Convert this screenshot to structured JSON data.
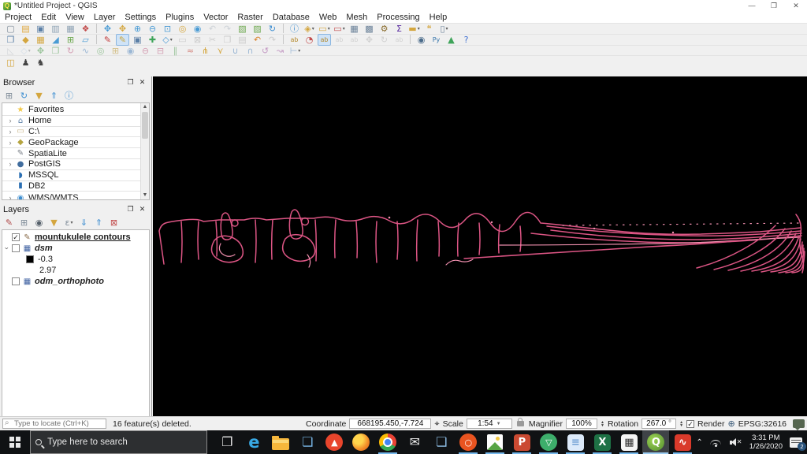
{
  "window": {
    "title": "*Untitled Project - QGIS",
    "minimize": "—",
    "restore": "❐",
    "close": "✕"
  },
  "menu": {
    "items": [
      "Project",
      "Edit",
      "View",
      "Layer",
      "Settings",
      "Plugins",
      "Vector",
      "Raster",
      "Database",
      "Web",
      "Mesh",
      "Processing",
      "Help"
    ]
  },
  "toolbars": {
    "row1": [
      {
        "n": "new-project-icon",
        "g": "▢",
        "c": "#7d8a97"
      },
      {
        "n": "open-project-icon",
        "g": "▤",
        "c": "#e0a93f"
      },
      {
        "n": "save-project-icon",
        "g": "▣",
        "c": "#5b7fa6"
      },
      {
        "n": "new-print-layout-icon",
        "g": "▥",
        "c": "#8fa3b5"
      },
      {
        "n": "layout-manager-icon",
        "g": "▦",
        "c": "#8fa3b5"
      },
      {
        "n": "style-manager-icon",
        "g": "❖",
        "c": "#c24d4d"
      },
      {
        "n": "separator"
      },
      {
        "n": "pan-map-icon",
        "g": "✥",
        "c": "#4a9bd4"
      },
      {
        "n": "pan-to-selection-icon",
        "g": "✥",
        "c": "#d4a63f"
      },
      {
        "n": "zoom-in-icon",
        "g": "⊕",
        "c": "#4a9bd4"
      },
      {
        "n": "zoom-out-icon",
        "g": "⊖",
        "c": "#4a9bd4"
      },
      {
        "n": "zoom-full-icon",
        "g": "⊡",
        "c": "#4a9bd4"
      },
      {
        "n": "zoom-to-selection-icon",
        "g": "◎",
        "c": "#d4a63f"
      },
      {
        "n": "zoom-to-layer-icon",
        "g": "◉",
        "c": "#4a9bd4"
      },
      {
        "n": "zoom-last-icon",
        "g": "↶",
        "c": "#8a9aa8",
        "d": 1
      },
      {
        "n": "zoom-next-icon",
        "g": "↷",
        "c": "#8a9aa8",
        "d": 1
      },
      {
        "n": "new-map-view-icon",
        "g": "▧",
        "c": "#6da84f"
      },
      {
        "n": "new-3d-map-view-icon",
        "g": "▨",
        "c": "#6da84f"
      },
      {
        "n": "refresh-map-icon",
        "g": "↻",
        "c": "#3f8fd1"
      },
      {
        "n": "separator"
      },
      {
        "n": "identify-features-icon",
        "g": "ⓘ",
        "c": "#3f8fd1"
      },
      {
        "n": "run-feature-action-icon",
        "g": "◈",
        "c": "#d4a63f",
        "v": 1
      },
      {
        "n": "select-features-icon",
        "g": "▭",
        "c": "#d4a63f",
        "v": 1
      },
      {
        "n": "deselect-features-icon",
        "g": "▭",
        "c": "#c24d4d",
        "v": 1
      },
      {
        "n": "open-attribute-table-icon",
        "g": "▦",
        "c": "#6b8299"
      },
      {
        "n": "field-calculator-icon",
        "g": "▩",
        "c": "#6b8299"
      },
      {
        "n": "processing-toolbox-icon",
        "g": "⚙",
        "c": "#8a6d2f"
      },
      {
        "n": "statistics-icon",
        "g": "Σ",
        "c": "#5a2ca0"
      },
      {
        "n": "measure-icon",
        "g": "▬",
        "c": "#d4a63f",
        "v": 1
      },
      {
        "n": "map-tips-icon",
        "g": "❝",
        "c": "#d4a63f"
      },
      {
        "n": "text-annotation-icon",
        "g": "▯",
        "c": "#6b8299",
        "v": 1
      }
    ],
    "row2": [
      {
        "n": "data-source-manager-icon",
        "g": "❐",
        "c": "#5b7fa6"
      },
      {
        "n": "add-vector-layer-icon",
        "g": "◆",
        "c": "#d4a63f"
      },
      {
        "n": "add-raster-layer-icon",
        "g": "▦",
        "c": "#d4a63f"
      },
      {
        "n": "add-mesh-layer-icon",
        "g": "◢",
        "c": "#4a9bd4"
      },
      {
        "n": "add-delimited-text-icon",
        "g": "⊞",
        "c": "#6da84f"
      },
      {
        "n": "new-shapefile-layer-icon",
        "g": "▱",
        "c": "#4a9bd4"
      },
      {
        "n": "separator"
      },
      {
        "n": "current-edits-icon",
        "g": "✎",
        "c": "#c23b3b"
      },
      {
        "n": "toggle-editing-icon",
        "g": "✎",
        "c": "#caa53d",
        "a": 1
      },
      {
        "n": "save-layer-edits-icon",
        "g": "▣",
        "c": "#5b7fa6"
      },
      {
        "n": "add-line-feature-icon",
        "g": "✚",
        "c": "#3fa45a"
      },
      {
        "n": "vertex-tool-icon",
        "g": "◇",
        "c": "#4a9bd4",
        "v": 1
      },
      {
        "n": "modify-attributes-icon",
        "g": "▭",
        "c": "#888",
        "d": 1
      },
      {
        "n": "delete-selected-icon",
        "g": "⊠",
        "c": "#888",
        "d": 1
      },
      {
        "n": "cut-features-icon",
        "g": "✂",
        "c": "#888",
        "d": 1
      },
      {
        "n": "copy-features-icon",
        "g": "❐",
        "c": "#888",
        "d": 1
      },
      {
        "n": "paste-features-icon",
        "g": "▤",
        "c": "#888",
        "d": 1
      },
      {
        "n": "undo-icon",
        "g": "↶",
        "c": "#d9822b"
      },
      {
        "n": "redo-icon",
        "g": "↷",
        "c": "#888",
        "d": 1
      },
      {
        "n": "separator"
      },
      {
        "n": "layer-labeling-icon",
        "g": "ab",
        "c": "#b58a2f"
      },
      {
        "n": "layer-diagrams-icon",
        "g": "◔",
        "c": "#c24d4d"
      },
      {
        "n": "highlight-labels-icon",
        "g": "ab",
        "c": "#b58a2f",
        "a": 1
      },
      {
        "n": "pin-labels-icon",
        "g": "ab",
        "c": "#999",
        "d": 1
      },
      {
        "n": "show-hide-labels-icon",
        "g": "ab",
        "c": "#999",
        "d": 1
      },
      {
        "n": "move-label-icon",
        "g": "✥",
        "c": "#999",
        "d": 1
      },
      {
        "n": "rotate-label-icon",
        "g": "↻",
        "c": "#999",
        "d": 1
      },
      {
        "n": "change-label-icon",
        "g": "ab",
        "c": "#999",
        "d": 1
      },
      {
        "n": "separator"
      },
      {
        "n": "metasearch-icon",
        "g": "◉",
        "c": "#4a6b8a"
      },
      {
        "n": "python-console-icon",
        "g": "Py",
        "c": "#3776ab"
      },
      {
        "n": "basemap-plugin-icon",
        "g": "▲",
        "c": "#3fa45a"
      },
      {
        "n": "help-contents-icon",
        "g": "?",
        "c": "#3f6fd1"
      }
    ],
    "row3": [
      {
        "n": "advanced-digitizing-icon",
        "g": "◺",
        "c": "#a0a8b0",
        "d": 1
      },
      {
        "n": "cad-tools-icon",
        "g": "◇",
        "c": "#9bb7d4",
        "v": 1,
        "d": 1
      },
      {
        "n": "move-feature-icon",
        "g": "✥",
        "c": "#9bc49b"
      },
      {
        "n": "copy-move-feature-icon",
        "g": "❐",
        "c": "#9bc49b"
      },
      {
        "n": "rotate-feature-icon",
        "g": "↻",
        "c": "#d4a0b4"
      },
      {
        "n": "simplify-feature-icon",
        "g": "∿",
        "c": "#9bb7d4"
      },
      {
        "n": "add-ring-icon",
        "g": "◎",
        "c": "#9bc49b"
      },
      {
        "n": "add-part-icon",
        "g": "⊞",
        "c": "#d4c08a"
      },
      {
        "n": "fill-ring-icon",
        "g": "◉",
        "c": "#9bb7d4"
      },
      {
        "n": "delete-ring-icon",
        "g": "⊖",
        "c": "#d4a0b4"
      },
      {
        "n": "delete-part-icon",
        "g": "⊟",
        "c": "#d4a0b4"
      },
      {
        "n": "offset-curve-icon",
        "g": "∥",
        "c": "#9bc49b"
      },
      {
        "n": "reshape-features-icon",
        "g": "≈",
        "c": "#d4877f"
      },
      {
        "n": "split-features-icon",
        "g": "⋔",
        "c": "#d4a63f"
      },
      {
        "n": "split-parts-icon",
        "g": "⋎",
        "c": "#d4a63f"
      },
      {
        "n": "merge-features-icon",
        "g": "∪",
        "c": "#9bb7d4"
      },
      {
        "n": "merge-attributes-icon",
        "g": "∩",
        "c": "#9bb7d4"
      },
      {
        "n": "rotate-point-symbols-icon",
        "g": "↺",
        "c": "#c49bc4"
      },
      {
        "n": "offset-point-symbol-icon",
        "g": "↝",
        "c": "#c49bc4"
      },
      {
        "n": "trim-extend-icon",
        "g": "⊢",
        "c": "#9bb7d4",
        "v": 1
      }
    ],
    "row4": [
      {
        "n": "db-manager-plugin-icon",
        "g": "◫",
        "c": "#d4a63f"
      },
      {
        "n": "plugin-tool-icon-1",
        "g": "♟",
        "c": "#444444"
      },
      {
        "n": "plugin-tool-icon-2",
        "g": "♞",
        "c": "#444444"
      }
    ]
  },
  "browser": {
    "title": "Browser",
    "tools": [
      {
        "n": "add-selected-layers-icon",
        "g": "⊞",
        "c": "#7d8a97"
      },
      {
        "n": "refresh-browser-icon",
        "g": "↻",
        "c": "#3f8fd1"
      },
      {
        "n": "filter-browser-icon",
        "g": "▼",
        "c": "#d4a63f"
      },
      {
        "n": "collapse-all-icon",
        "g": "⇑",
        "c": "#3f8fd1"
      },
      {
        "n": "browser-properties-icon",
        "g": "ⓘ",
        "c": "#3f8fd1"
      }
    ],
    "items": [
      {
        "n": "browser-item-favorites",
        "icon": "favorites-star-icon",
        "g": "★",
        "c": "#f2c744",
        "label": "Favorites",
        "arrow": false
      },
      {
        "n": "browser-item-home",
        "icon": "home-icon",
        "g": "⌂",
        "c": "#5b7fa6",
        "label": "Home",
        "arrow": true
      },
      {
        "n": "browser-item-c-drive",
        "icon": "folder-icon",
        "g": "▭",
        "c": "#c9b68a",
        "label": "C:\\",
        "arrow": true
      },
      {
        "n": "browser-item-geopackage",
        "icon": "geopackage-icon",
        "g": "◆",
        "c": "#b5a43f",
        "label": "GeoPackage",
        "arrow": true
      },
      {
        "n": "browser-item-spatialite",
        "icon": "spatialite-icon",
        "g": "✎",
        "c": "#7a8088",
        "label": "SpatiaLite",
        "arrow": false
      },
      {
        "n": "browser-item-postgis",
        "icon": "postgis-elephant-icon",
        "g": "●",
        "c": "#416d9e",
        "label": "PostGIS",
        "arrow": true
      },
      {
        "n": "browser-item-mssql",
        "icon": "mssql-icon",
        "g": "◗",
        "c": "#2b6fb3",
        "label": "MSSQL",
        "arrow": false
      },
      {
        "n": "browser-item-db2",
        "icon": "db2-icon",
        "g": "▮",
        "c": "#2b6fb3",
        "label": "DB2",
        "arrow": false
      },
      {
        "n": "browser-item-wms",
        "icon": "wms-globe-icon",
        "g": "◉",
        "c": "#3f8fd1",
        "label": "WMS/WMTS",
        "arrow": true
      }
    ]
  },
  "layers": {
    "title": "Layers",
    "tools": [
      {
        "n": "layer-styling-icon",
        "g": "✎",
        "c": "#b04a4a"
      },
      {
        "n": "add-group-icon",
        "g": "⊞",
        "c": "#7d8a97"
      },
      {
        "n": "map-themes-icon",
        "g": "◉",
        "c": "#55606a"
      },
      {
        "n": "filter-legend-icon",
        "g": "▼",
        "c": "#d4a63f"
      },
      {
        "n": "filter-expression-icon",
        "g": "ε",
        "c": "#7d8a97",
        "v": 1
      },
      {
        "n": "expand-all-icon",
        "g": "⇓",
        "c": "#3f8fd1"
      },
      {
        "n": "collapse-all-layers-icon",
        "g": "⇑",
        "c": "#3f8fd1"
      },
      {
        "n": "remove-layer-icon",
        "g": "⊠",
        "c": "#c24d4d"
      }
    ],
    "items": [
      {
        "type": "layer",
        "n": "layer-item-mountukulele-contours",
        "checked": true,
        "icon": "vector-line-layer-icon",
        "g": "✎",
        "c": "#8a6d4b",
        "label": "mountukulele contours",
        "style": "bold-underline"
      },
      {
        "type": "layer",
        "n": "layer-item-dsm",
        "expand": true,
        "checked": false,
        "icon": "raster-layer-icon",
        "g": "▦",
        "c": "#3c5fa0",
        "label": "dsm",
        "style": "italic"
      },
      {
        "type": "legend",
        "n": "legend-entry-min",
        "swatch": "#000000",
        "label": "-0.3"
      },
      {
        "type": "legend",
        "n": "legend-entry-max",
        "swatch": "",
        "label": "2.97"
      },
      {
        "type": "layer",
        "n": "layer-item-odm-orthophoto",
        "checked": false,
        "icon": "raster-layer-icon",
        "g": "▦",
        "c": "#3c5fa0",
        "label": "odm_orthophoto",
        "style": "italic"
      }
    ]
  },
  "map": {
    "contour_color": "#dc5584",
    "contour_light": "#ef8fae",
    "background": "#000000"
  },
  "statusbar": {
    "locate_placeholder": "Type to locate (Ctrl+K)",
    "message": "16 feature(s) deleted.",
    "coordinate_label": "Coordinate",
    "coordinate_value": "668195.450,-7.724",
    "scale_label": "Scale",
    "scale_value": "1:54",
    "magnifier_label": "Magnifier",
    "magnifier_value": "100%",
    "rotation_label": "Rotation",
    "rotation_value": "267.0",
    "rotation_unit": "°",
    "render_label": "Render",
    "crs": "EPSG:32616"
  },
  "taskbar": {
    "search_placeholder": "Type here to search",
    "apps": [
      {
        "n": "task-view-button",
        "shape": "plain",
        "g": "❐",
        "fg": "#e8e8e8"
      },
      {
        "n": "edge-icon",
        "shape": "edge",
        "g": "e"
      },
      {
        "n": "file-explorer-icon",
        "shape": "folder"
      },
      {
        "n": "remote-desktop-icon",
        "shape": "plain",
        "g": "❏",
        "fg": "#79b7e8"
      },
      {
        "n": "brave-icon",
        "shape": "circle",
        "bg": "#e8452c",
        "g": "▲",
        "fg": "#ffffff"
      },
      {
        "n": "firefox-icon",
        "shape": "firefox"
      },
      {
        "n": "chrome-icon",
        "shape": "chrome",
        "run": 1
      },
      {
        "n": "mail-icon",
        "shape": "plain",
        "g": "✉",
        "fg": "#f0f0f0"
      },
      {
        "n": "network-computers-icon",
        "shape": "plain",
        "g": "❏",
        "fg": "#8fc0e8"
      },
      {
        "n": "ubuntu-icon",
        "shape": "circle",
        "bg": "#e95420",
        "g": "○",
        "fg": "#ffffff",
        "run": 1
      },
      {
        "n": "photos-app-icon",
        "shape": "photos",
        "run": 1
      },
      {
        "n": "powerpoint-icon",
        "shape": "rounded",
        "bg": "#cb4a32",
        "g": "P",
        "fg": "#ffffff",
        "run": 1
      },
      {
        "n": "green-triangle-app-icon",
        "shape": "circle",
        "bg": "#3dae6b",
        "g": "▽",
        "fg": "#ffffff",
        "run": 1
      },
      {
        "n": "notepad-app-icon",
        "shape": "rounded",
        "bg": "#dceafa",
        "g": "≡",
        "fg": "#6f9fd4",
        "run": 1
      },
      {
        "n": "excel-icon",
        "shape": "rounded",
        "bg": "#1e7145",
        "g": "X",
        "fg": "#ffffff",
        "run": 1
      },
      {
        "n": "calculator-icon",
        "shape": "rounded",
        "bg": "#f5f5f5",
        "g": "▦",
        "fg": "#333333",
        "run": 1
      },
      {
        "n": "qgis-taskbar-icon",
        "shape": "qgis",
        "g": "Q",
        "fg": "#ffffff",
        "run": 1,
        "act": 1
      },
      {
        "n": "red-s-app-icon",
        "shape": "rounded",
        "bg": "#d93a2b",
        "g": "∿",
        "fg": "#ffffff",
        "run": 1
      }
    ],
    "tray": {
      "time": "3:31 PM",
      "date": "1/26/2020",
      "notification_badge": "2"
    }
  }
}
